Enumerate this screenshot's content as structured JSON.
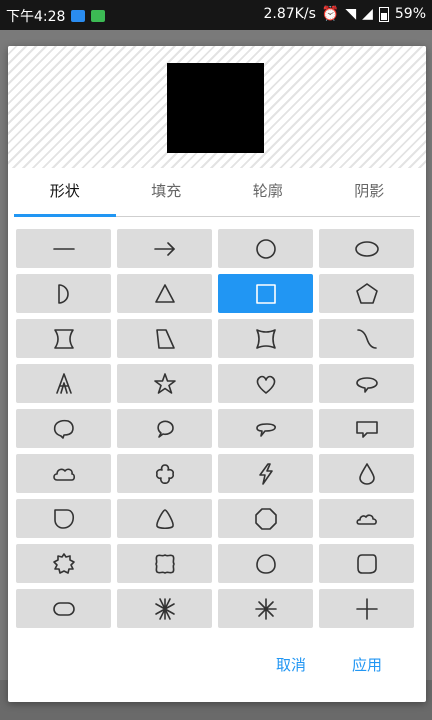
{
  "status_bar": {
    "time": "下午4:28",
    "network_speed": "2.87K/s",
    "battery": "59%"
  },
  "tabs": [
    {
      "label": "形状",
      "active": true
    },
    {
      "label": "填充",
      "active": false
    },
    {
      "label": "轮廓",
      "active": false
    },
    {
      "label": "阴影",
      "active": false
    }
  ],
  "shapes": [
    {
      "name": "line-icon"
    },
    {
      "name": "arrow-icon"
    },
    {
      "name": "circle-icon"
    },
    {
      "name": "ellipse-icon"
    },
    {
      "name": "half-circle-icon"
    },
    {
      "name": "triangle-icon"
    },
    {
      "name": "square-icon",
      "selected": true
    },
    {
      "name": "pentagon-icon"
    },
    {
      "name": "hourglass-icon"
    },
    {
      "name": "trapezoid-icon"
    },
    {
      "name": "concave-square-icon"
    },
    {
      "name": "curve-icon"
    },
    {
      "name": "letter-a-icon"
    },
    {
      "name": "star-icon"
    },
    {
      "name": "heart-icon"
    },
    {
      "name": "oval-speech-bubble-icon"
    },
    {
      "name": "round-speech-bubble-icon"
    },
    {
      "name": "circle-speech-bubble-icon"
    },
    {
      "name": "flat-speech-bubble-icon"
    },
    {
      "name": "rect-speech-bubble-icon"
    },
    {
      "name": "cloud-icon"
    },
    {
      "name": "flower-icon"
    },
    {
      "name": "lightning-icon"
    },
    {
      "name": "drop-icon"
    },
    {
      "name": "leaf-shape-icon"
    },
    {
      "name": "rounded-triangle-icon"
    },
    {
      "name": "octagon-icon"
    },
    {
      "name": "cloud-small-icon"
    },
    {
      "name": "sun-icon"
    },
    {
      "name": "scalloped-square-icon"
    },
    {
      "name": "blob-circle-icon"
    },
    {
      "name": "rounded-square-icon"
    },
    {
      "name": "rounded-oval-icon"
    },
    {
      "name": "asterisk-burst-icon"
    },
    {
      "name": "asterisk-icon"
    },
    {
      "name": "plus-icon"
    }
  ],
  "buttons": {
    "cancel": "取消",
    "apply": "应用"
  },
  "colors": {
    "accent": "#2196f3",
    "cell_bg": "#dcdcdc"
  }
}
